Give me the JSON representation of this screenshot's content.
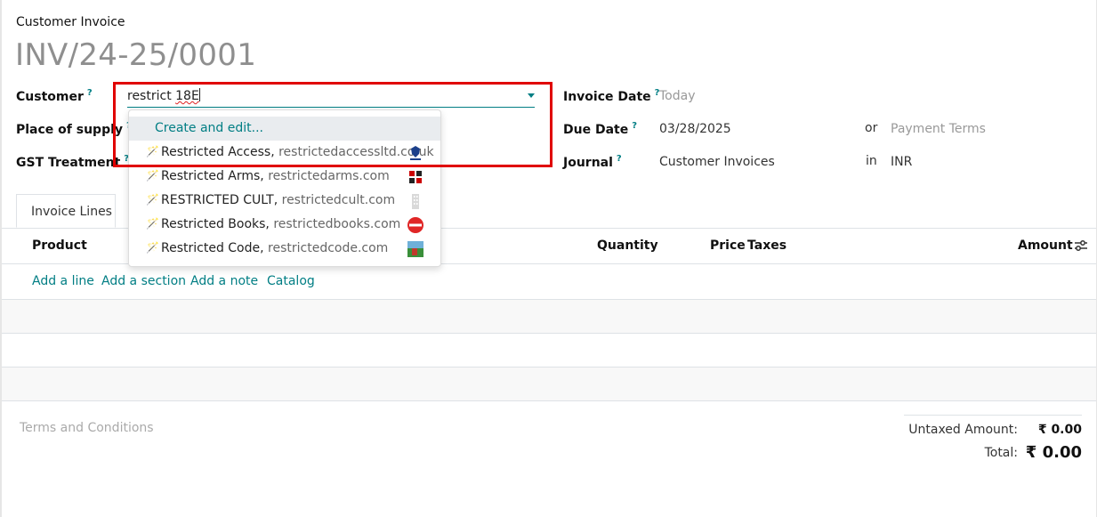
{
  "header": {
    "doc_type": "Customer Invoice",
    "doc_number": "INV/24-25/0001"
  },
  "form": {
    "customer": {
      "label": "Customer",
      "help": "?",
      "value_plain": "restrict ",
      "value_squiggle": "18E"
    },
    "place_of_supply": {
      "label": "Place of supply",
      "help": "?"
    },
    "gst_treatment": {
      "label": "GST Treatment",
      "help": "?"
    },
    "invoice_date": {
      "label": "Invoice Date",
      "help": "?",
      "placeholder": "Today"
    },
    "due_date": {
      "label": "Due Date",
      "help": "?",
      "value": "03/28/2025",
      "or_text": "or",
      "payment_terms_placeholder": "Payment Terms"
    },
    "journal": {
      "label": "Journal",
      "help": "?",
      "value": "Customer Invoices",
      "in_text": "in",
      "currency": "INR"
    }
  },
  "dropdown": {
    "create_label": "Create and edit...",
    "items": [
      {
        "name": "Restricted Access,",
        "domain": " restrictedaccessltd.co.uk",
        "logo": "restricted-access-logo"
      },
      {
        "name": "Restricted Arms,",
        "domain": " restrictedarms.com",
        "logo": "restricted-arms-logo"
      },
      {
        "name": "RESTRICTED CULT,",
        "domain": " restrictedcult.com",
        "logo": "building-placeholder-logo"
      },
      {
        "name": "Restricted Books,",
        "domain": " restrictedbooks.com",
        "logo": "restricted-books-logo"
      },
      {
        "name": "Restricted Code,",
        "domain": " restrictedcode.com",
        "logo": "restricted-code-logo"
      }
    ]
  },
  "tabs": [
    {
      "label": "Invoice Lines"
    }
  ],
  "table": {
    "columns": {
      "product": "Product",
      "quantity": "Quantity",
      "price": "Price",
      "taxes": "Taxes",
      "amount": "Amount"
    },
    "actions": [
      "Add a line",
      "Add a section",
      "Add a note",
      "Catalog"
    ]
  },
  "footer": {
    "terms_placeholder": "Terms and Conditions",
    "untaxed_label": "Untaxed Amount:",
    "untaxed_value": "₹ 0.00",
    "total_label": "Total:",
    "total_value": "₹ 0.00"
  },
  "colors": {
    "accent": "#017e84",
    "highlight": "#e00000"
  }
}
